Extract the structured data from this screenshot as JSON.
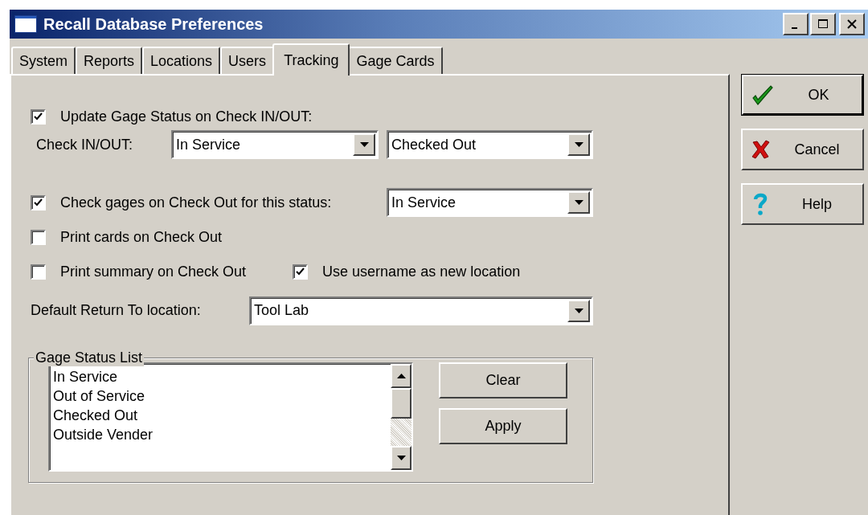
{
  "window": {
    "title": "Recall Database Preferences"
  },
  "tabs": [
    {
      "label": "System",
      "selected": false
    },
    {
      "label": "Reports",
      "selected": false
    },
    {
      "label": "Locations",
      "selected": false
    },
    {
      "label": "Users",
      "selected": false
    },
    {
      "label": "Tracking",
      "selected": true
    },
    {
      "label": "Gage Cards",
      "selected": false
    }
  ],
  "tracking": {
    "update_status": {
      "label": "Update Gage Status on Check IN/OUT:",
      "checked": true
    },
    "check_in_out": {
      "label": "Check IN/OUT:",
      "in_value": "In Service",
      "out_value": "Checked Out"
    },
    "check_gages": {
      "label": "Check gages on Check Out for this status:",
      "checked": true,
      "value": "In Service"
    },
    "print_cards": {
      "label": "Print cards on Check Out",
      "checked": false
    },
    "print_summary": {
      "label": "Print summary on Check Out",
      "checked": false
    },
    "use_username": {
      "label": "Use username as new location",
      "checked": true
    },
    "default_return": {
      "label": "Default Return To location:",
      "value": "Tool Lab"
    },
    "status_list": {
      "title": "Gage Status List",
      "items": [
        "In Service",
        "Out of Service",
        "Checked Out",
        "Outside Vender"
      ],
      "buttons": [
        "Clear",
        "Apply"
      ]
    }
  },
  "buttons": [
    {
      "label": "OK",
      "kind": "ok"
    },
    {
      "label": "Cancel",
      "kind": "cancel"
    },
    {
      "label": "Help",
      "kind": "help"
    }
  ]
}
